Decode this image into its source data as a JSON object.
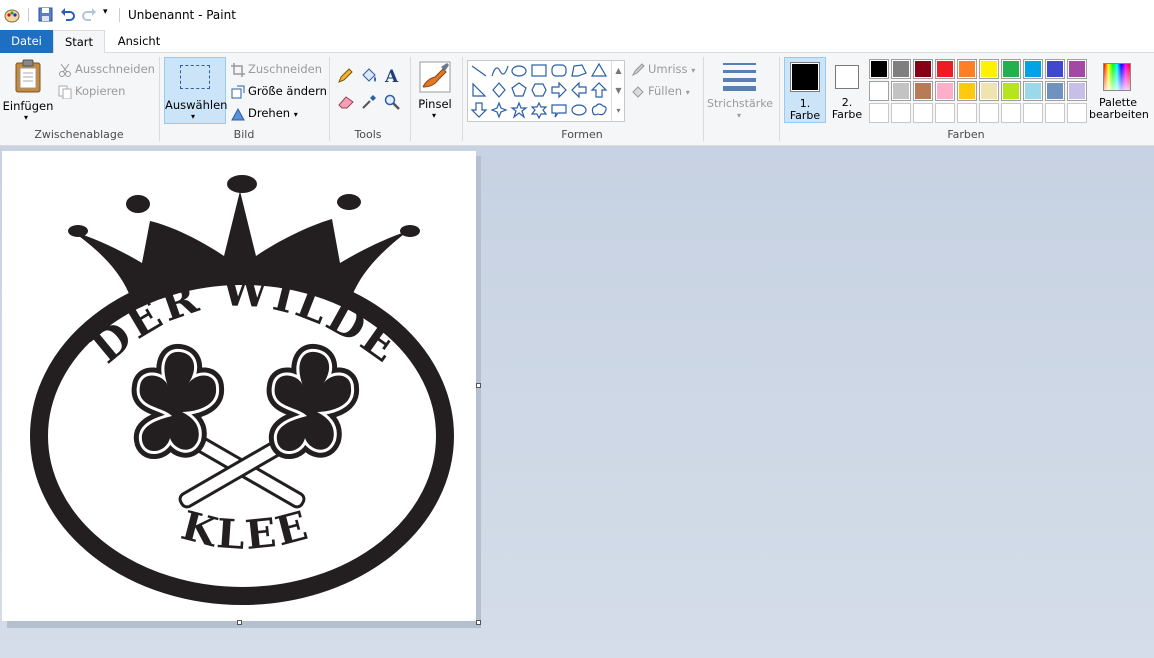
{
  "titlebar": {
    "title": "Unbenannt - Paint"
  },
  "tabs": {
    "file": "Datei",
    "start": "Start",
    "view": "Ansicht"
  },
  "clipboard": {
    "paste": "Einfügen",
    "cut": "Ausschneiden",
    "copy": "Kopieren",
    "label": "Zwischenablage"
  },
  "image": {
    "select": "Auswählen",
    "crop": "Zuschneiden",
    "resize": "Größe ändern",
    "rotate": "Drehen",
    "label": "Bild"
  },
  "tools": {
    "label": "Tools"
  },
  "brushes": {
    "label": "Pinsel"
  },
  "shapes": {
    "outline": "Umriss",
    "fill": "Füllen",
    "label": "Formen"
  },
  "stroke": {
    "label": "Strichstärke"
  },
  "colors": {
    "color1_line1": "1.",
    "color1_line2": "Farbe",
    "color2_line1": "2.",
    "color2_line2": "Farbe",
    "edit_line1": "Palette",
    "edit_line2": "bearbeiten",
    "label": "Farben",
    "color1": "#000000",
    "color2": "#ffffff",
    "row1": [
      "#000000",
      "#7f7f7f",
      "#880015",
      "#ed1c24",
      "#ff7f27",
      "#fff200",
      "#22b14c",
      "#00a2e8",
      "#3f48cc",
      "#a349a4"
    ],
    "row2": [
      "#ffffff",
      "#c3c3c3",
      "#b97a57",
      "#ffaec9",
      "#ffc90e",
      "#efe4b0",
      "#b5e61d",
      "#99d9ea",
      "#7092be",
      "#c8bfe7"
    ]
  },
  "artwork": {
    "top_text": "DER WILDE",
    "bottom_text": "KLEE"
  }
}
